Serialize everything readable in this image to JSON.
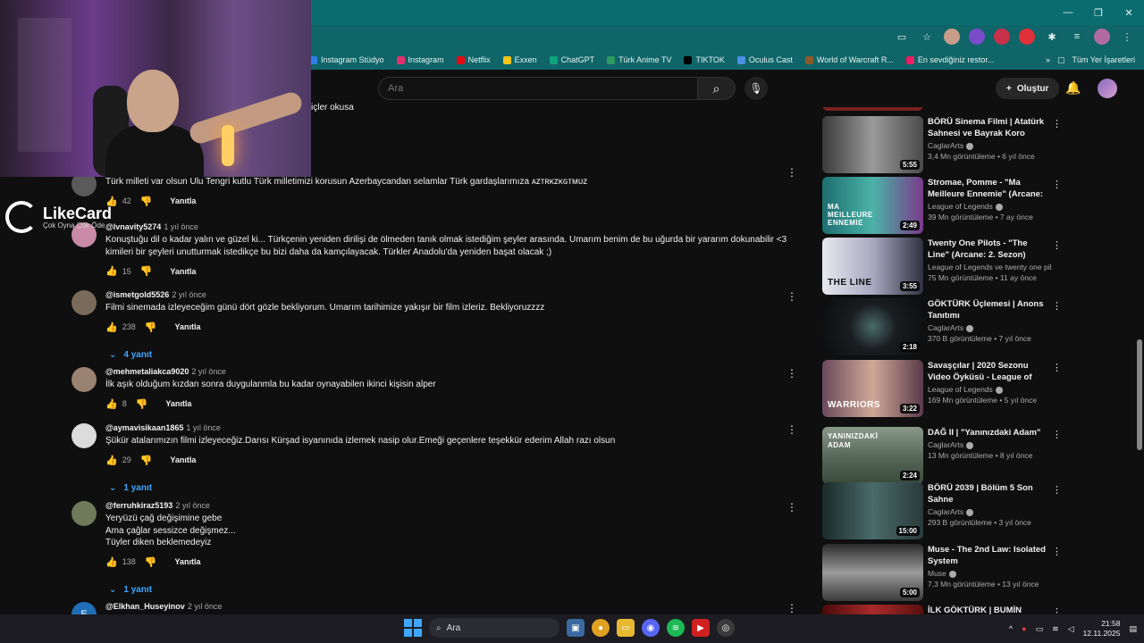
{
  "browser": {
    "window_controls": [
      "—",
      "❐",
      "✕"
    ],
    "bookmarks": [
      {
        "label": "Instagram Stüdyo",
        "color": "#2f7fe8"
      },
      {
        "label": "Instagram",
        "color": "#e1306c"
      },
      {
        "label": "Netflix",
        "color": "#e50914"
      },
      {
        "label": "Exxen",
        "color": "#f5c518"
      },
      {
        "label": "ChatGPT",
        "color": "#10a37f"
      },
      {
        "label": "Türk Anime TV",
        "color": "#2f9a5f"
      },
      {
        "label": "TIKTOK",
        "color": "#000000"
      },
      {
        "label": "Oculus Cast",
        "color": "#4a90e2"
      },
      {
        "label": "World of Warcraft R...",
        "color": "#8b5a2b"
      },
      {
        "label": "En sevdiğiniz restor...",
        "color": "#e91e63"
      }
    ],
    "bookmarks_more": "»",
    "all_bookmarks": "Tüm Yer İşaretleri"
  },
  "header": {
    "search_placeholder": "Ara",
    "create_label": "Oluştur",
    "create_icon": "+"
  },
  "overlay": {
    "brand_name": "LikeCard",
    "brand_sub": "Çok Oyna Çok Öde"
  },
  "partial_comment_text": "içler okusa",
  "comments": [
    {
      "author": "",
      "time": "",
      "text": "Türk milleti var olsun Ulu Tengri kutlu Türk milletimizi korusun Azerbaycandan selamlar Türk gardaşlarımıza ᴀᴢᴛʀᴋᴢᴋɢᴛᴍᴜᴢ",
      "likes": "42",
      "reply_label": "Yanıtla",
      "replies": "",
      "avatar_color": "#5a5a5a"
    },
    {
      "author": "@lvnavity5274",
      "time": "1 yıl önce",
      "text": "Konuştuğu dil o kadar yalın ve güzel ki... Türkçenin yeniden dirilişi de ölmeden tanık olmak istediğim şeyler arasında. Umarım benim de bu uğurda bir yararım dokunabilir <3 kimileri bir şeyleri unutturmak istedikçe bu bizi daha da kamçılayacak. Türkler Anadolu'da yeniden başat olacak ;)",
      "likes": "15",
      "reply_label": "Yanıtla",
      "replies": "",
      "avatar_color": "#c98aa6"
    },
    {
      "author": "@ismetgold5526",
      "time": "2 yıl önce",
      "text": "Filmi sinemada izleyeceğim günü dört gözle bekliyorum. Umarım tarihimize yakışır bir film izleriz. Bekliyoruzzzz",
      "likes": "238",
      "reply_label": "Yanıtla",
      "replies": "4 yanıt",
      "avatar_color": "#7a6a5a"
    },
    {
      "author": "@mehmetaliakca9020",
      "time": "2 yıl önce",
      "text": "İlk aşık olduğum kızdan sonra duygulanmla bu kadar oynayabilen ikinci kişisin alper",
      "likes": "8",
      "reply_label": "Yanıtla",
      "replies": "",
      "avatar_color": "#9a8272"
    },
    {
      "author": "@aymavisikaan1865",
      "time": "1 yıl önce",
      "text": "Şükür atalarımızın filmi izleyeceğiz.Darısı Kürşad isyanınıda izlemek nasip olur.Emeği geçenlere teşekkür ederim Allah razı olsun",
      "likes": "29",
      "reply_label": "Yanıtla",
      "replies": "1 yanıt",
      "avatar_color": "#dcdcdc"
    },
    {
      "author": "@ferruhkiraz5193",
      "time": "2 yıl önce",
      "text": "Yeryüzü çağ değişimine gebe\nAma çağlar sessizce değişmez...\nTüyler diken beklemedeyiz",
      "likes": "138",
      "reply_label": "Yanıtla",
      "replies": "1 yanıt",
      "avatar_color": "#6e7a5a"
    },
    {
      "author": "@Elkhan_Huseyinov",
      "time": "2 yıl önce",
      "text": "",
      "likes": "",
      "reply_label": "",
      "replies": "",
      "avatar_color": "#1f6fb8",
      "avatar_letter": "E"
    }
  ],
  "sidebar": [
    {
      "title": "BÖRÜ Sinema Filmi | Atatürk Sahnesi ve Bayrak Koro",
      "channel": "CaglarArts",
      "verified": true,
      "meta": "3,4 Mn görüntüleme • 6 yıl önce",
      "duration": "5:55",
      "thumb_color": "#6a6a6a",
      "thumb_label": ""
    },
    {
      "title": "Stromae, Pomme - \"Ma Meilleure Ennemie\" (Arcane: 2....",
      "channel": "League of Legends",
      "verified": true,
      "meta": "39 Mn görüntüleme • 7 ay önce",
      "duration": "2:49",
      "thumb_color": "#2f8f8a",
      "thumb_label": "MA MEILLEURE ENNEMIE"
    },
    {
      "title": "Twenty One Pilots - \"The Line\" (Arcane: 2. Sezon) [Resmi ...",
      "channel": "League of Legends ve twenty one pil...",
      "verified": true,
      "meta": "75 Mn görüntüleme • 11 ay önce",
      "duration": "3:55",
      "thumb_color": "#c8c8d0",
      "thumb_label": "THE LINE"
    },
    {
      "title": "GÖKTÜRK Üçlemesi | Anons Tanıtımı",
      "channel": "CaglarArts",
      "verified": true,
      "meta": "370 B görüntüleme • 7 yıl önce",
      "duration": "2:18",
      "thumb_color": "#1a1d20",
      "thumb_label": ""
    },
    {
      "title": "Savaşçılar | 2020 Sezonu Video Öyküsü - League of Legends (f...",
      "channel": "League of Legends",
      "verified": true,
      "meta": "169 Mn görüntüleme • 5 yıl önce",
      "duration": "3:22",
      "thumb_color": "#b08a7a",
      "thumb_label": "WARRIORS"
    },
    {
      "title": "DAĞ II | \"Yanınızdaki Adam\"",
      "channel": "CaglarArts",
      "verified": true,
      "meta": "13 Mn görüntüleme • 8 yıl önce",
      "duration": "2:24",
      "thumb_color": "#5a6a5a",
      "thumb_label": "YANINIZDAKİ ADAM"
    },
    {
      "title": "BÖRÜ 2039 | Bölüm 5 Son Sahne",
      "channel": "CaglarArts",
      "verified": true,
      "meta": "293 B görüntüleme • 3 yıl önce",
      "duration": "15:00",
      "thumb_color": "#2e4a4a",
      "thumb_label": ""
    },
    {
      "title": "Muse - The 2nd Law: Isolated System",
      "channel": "Muse",
      "verified": true,
      "meta": "7,3 Mn görüntüleme • 13 yıl önce",
      "duration": "5:00",
      "thumb_color": "#707070",
      "thumb_label": ""
    },
    {
      "title": "İLK GÖKTÜRK | BUMİN MİKRO",
      "channel": "",
      "verified": false,
      "meta": "",
      "duration": "",
      "thumb_color": "#7a1a1a",
      "thumb_label": ""
    }
  ],
  "taskbar": {
    "search_label": "Ara",
    "time": "21:58",
    "date": "12.11.2025"
  }
}
